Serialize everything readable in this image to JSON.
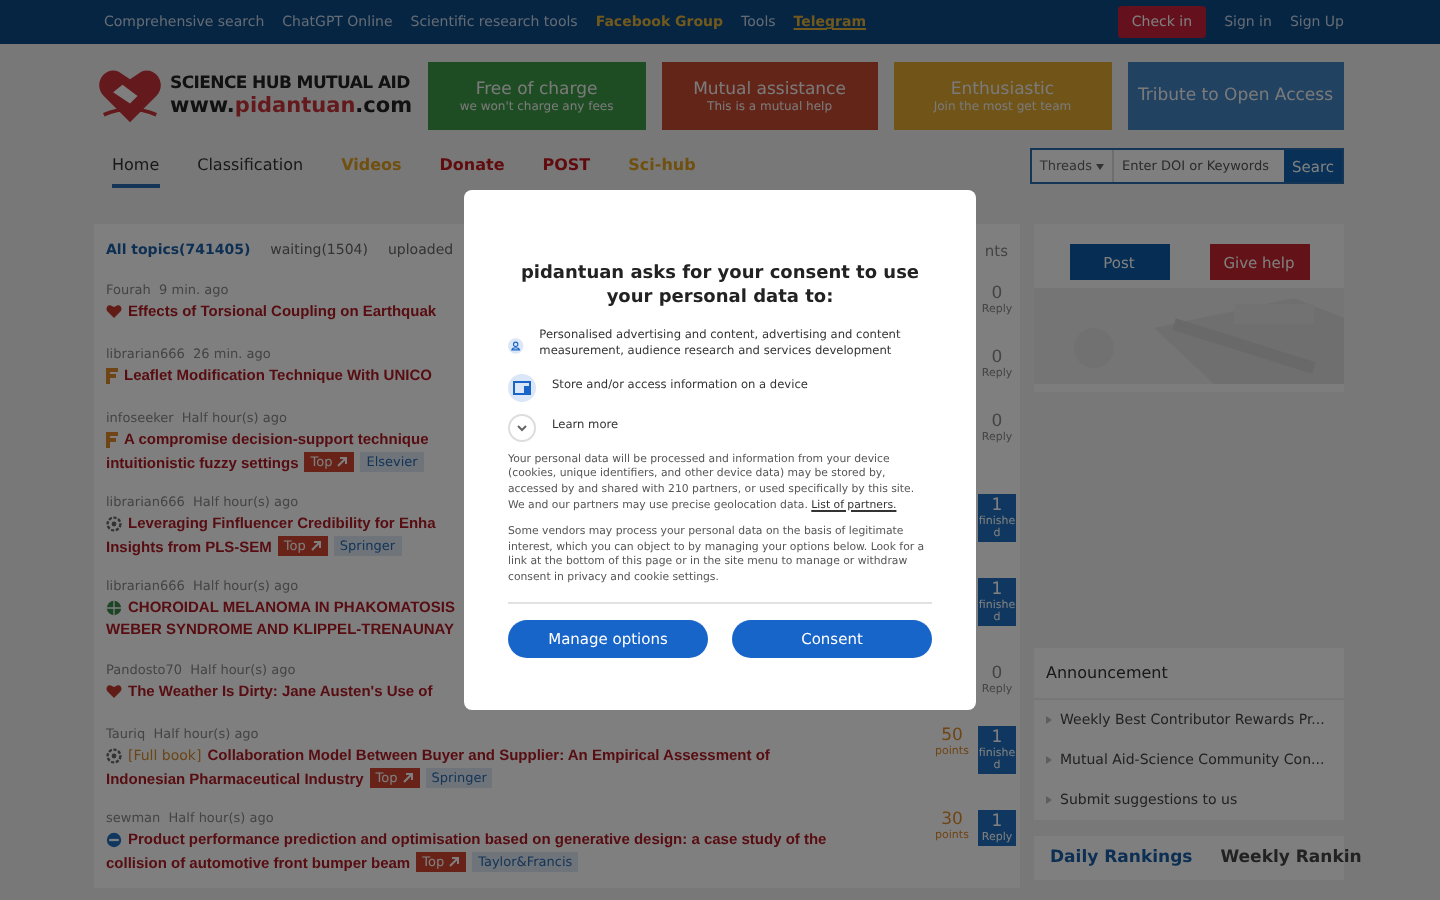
{
  "top_bar": {
    "links": [
      {
        "label": "Comprehensive search",
        "kind": "plain"
      },
      {
        "label": "ChatGPT Online",
        "kind": "plain"
      },
      {
        "label": "Scientific research tools",
        "kind": "plain"
      },
      {
        "label": "Facebook Group",
        "kind": "highlight"
      },
      {
        "label": "Tools",
        "kind": "plain"
      },
      {
        "label": "Telegram",
        "kind": "underline"
      }
    ],
    "check_in": "Check in",
    "sign_in": "Sign in",
    "sign_up": "Sign Up"
  },
  "logo": {
    "title": "SCIENCE HUB MUTUAL AID",
    "url_parts": [
      "www.",
      "pidantuan",
      ".com"
    ]
  },
  "banners": [
    {
      "title": "Free of charge",
      "subtitle": "we won't charge any fees"
    },
    {
      "title": "Mutual assistance",
      "subtitle": "This is a mutual help"
    },
    {
      "title": "Enthusiastic",
      "subtitle": "Join the most get team"
    },
    {
      "title": "Tribute to Open Access"
    }
  ],
  "nav": [
    {
      "label": "Home",
      "selected": true,
      "kind": "plain"
    },
    {
      "label": "Classification",
      "selected": false,
      "kind": "plain"
    },
    {
      "label": "Videos",
      "selected": false,
      "kind": "gold"
    },
    {
      "label": "Donate",
      "selected": false,
      "kind": "alert"
    },
    {
      "label": "POST",
      "selected": false,
      "kind": "alert"
    },
    {
      "label": "Sci-hub",
      "selected": false,
      "kind": "gold"
    }
  ],
  "search": {
    "scope": "Threads",
    "placeholder": "Enter DOI or Keywords",
    "button": "Searc"
  },
  "topic_filters": [
    {
      "label": "All topics(741405)",
      "selected": true
    },
    {
      "label": "waiting(1504)",
      "selected": false
    },
    {
      "label": "uploaded",
      "selected": false
    }
  ],
  "list_header_right": "nts",
  "topics": [
    {
      "user": "Fourah",
      "time": "9 min. ago",
      "lines": [
        "Effects of Torsional Coupling on Earthquak"
      ],
      "reply": {
        "count": "0",
        "label": "Reply",
        "answered": false
      }
    },
    {
      "user": "librarian666",
      "time": "26 min. ago",
      "lines": [
        "Leaflet Modification Technique With UNICO"
      ],
      "reply": {
        "count": "0",
        "label": "Reply",
        "answered": false
      }
    },
    {
      "user": "infoseeker",
      "time": "Half hour(s) ago",
      "lines": [
        "A compromise decision-support technique",
        "intuitionistic fuzzy settings"
      ],
      "tags": [
        {
          "kind": "top",
          "text": "Top"
        },
        {
          "kind": "publisher",
          "text": "Elsevier"
        }
      ],
      "reply": {
        "count": "0",
        "label": "Reply",
        "answered": false
      }
    },
    {
      "user": "librarian666",
      "time": "Half hour(s) ago",
      "lines": [
        "Leveraging Finfluencer Credibility for Enha",
        "Insights from PLS-SEM"
      ],
      "tags": [
        {
          "kind": "top",
          "text": "Top"
        },
        {
          "kind": "publisher",
          "text": "Springer"
        }
      ],
      "reply": {
        "count": "1",
        "label": "finished",
        "answered": true
      }
    },
    {
      "user": "librarian666",
      "time": "Half hour(s) ago",
      "lines": [
        "CHOROIDAL MELANOMA IN PHAKOMATOSIS",
        "WEBER SYNDROME AND KLIPPEL-TRENAUNAY"
      ],
      "reply": {
        "count": "1",
        "label": "finished",
        "answered": true
      }
    },
    {
      "user": "Pandosto70",
      "time": "Half hour(s) ago",
      "lines": [
        "The Weather Is Dirty: Jane Austen's Use of"
      ],
      "reply": {
        "count": "0",
        "label": "Reply",
        "answered": false
      }
    },
    {
      "user": "Tauriq",
      "time": "Half hour(s) ago",
      "prefix": "[Full book]",
      "lines": [
        "Collaboration Model Between Buyer and Supplier: An Empirical Assessment of",
        "Indonesian Pharmaceutical Industry"
      ],
      "tags": [
        {
          "kind": "top",
          "text": "Top"
        },
        {
          "kind": "publisher",
          "text": "Springer"
        }
      ],
      "points": {
        "value": "50",
        "label": "points"
      },
      "reply": {
        "count": "1",
        "label": "finished",
        "answered": true
      }
    },
    {
      "user": "sewman",
      "time": "Half hour(s) ago",
      "lines": [
        "Product performance prediction and optimisation based on generative design: a case study of the",
        "collision of automotive front bumper beam"
      ],
      "tags": [
        {
          "kind": "top",
          "text": "Top"
        },
        {
          "kind": "publisher",
          "text": "Taylor&Francis"
        }
      ],
      "points": {
        "value": "30",
        "label": "points"
      },
      "reply": {
        "count": "1",
        "label": "Reply",
        "answered": true
      }
    }
  ],
  "side_actions": {
    "post": "Post",
    "help": "Give help"
  },
  "announcement": {
    "title": "Announcement",
    "items": [
      "Weekly Best Contributor Rewards Pr...",
      "Mutual Aid-Science Community Con...",
      "Submit suggestions to us"
    ]
  },
  "rankings": [
    {
      "label": "Daily Rankings",
      "selected": true
    },
    {
      "label": "Weekly Rankin",
      "selected": false
    }
  ],
  "consent": {
    "title": "pidantuan asks for your consent to use your personal data to:",
    "purposes": [
      "Personalised advertising and content, advertising and content measurement, audience research and services development",
      "Store and/or access information on a device"
    ],
    "learn_more": "Learn more",
    "paragraphs": [
      {
        "text": "Your personal data will be processed and information from your device (cookies, unique identifiers, and other device data) may be stored by, accessed by and shared with 210 partners, or used specifically by this site. We and our partners may use precise geolocation data.",
        "link": "List of partners."
      },
      {
        "text": "Some vendors may process your personal data on the basis of legitimate interest, which you can object to by managing your options below. Look for a link at the bottom of this page or in the site menu to manage or withdraw consent in privacy and cookie settings."
      }
    ],
    "buttons": [
      "Manage options",
      "Consent"
    ]
  }
}
